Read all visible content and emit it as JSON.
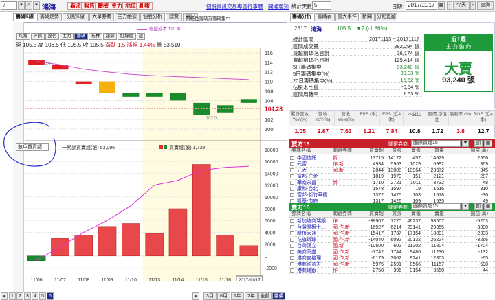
{
  "toolbar": {
    "code": "7",
    "stock_name": "鴻海",
    "buttons": [
      "看法",
      "報告",
      "體檢",
      "主力",
      "地位",
      "亂報"
    ],
    "links": [
      "個股資訊",
      "交易專區",
      "行事曆",
      "開通通知"
    ],
    "period_label": "統計天數:",
    "period_value": "5",
    "date_label": "日期:",
    "date_value": "2017/11/17",
    "today_btn": "今天",
    "query_btn": "查詢"
  },
  "left_tabs": [
    "籌碼K線",
    "籌碼走勢",
    "分點K線",
    "大單券商",
    "主力給據",
    "個股分析",
    "總覽",
    "筆記"
  ],
  "right_tabs": [
    "籌碼分析",
    "籌碼表",
    "重大事件",
    "新聞",
    "分點追蹤"
  ],
  "chart": {
    "note": "新紅色籌碼為籌碼集中",
    "avg_cost_label": "聯盟成本 110.40",
    "tools": [
      "均線",
      "外資",
      "投信",
      "主力",
      "籌碼",
      "布林",
      "趨勢",
      "紅綠燈"
    ],
    "active_tool": "籌碼",
    "tools_extra": "設",
    "ohlc_line": {
      "open": "開 105.5",
      "high": "高 106.5",
      "low": "低 105.5",
      "close": "收 105.5",
      "change": "漲跌 1.5",
      "pct": "漲幅 1.44%",
      "vol": "量 53,510"
    },
    "last_price": "104.28",
    "candle_hi_label": "114",
    "candle_lo_label": "102.5",
    "lower_selector": "散戶買賣超",
    "lower_legend_1": "一累計買賣超(張) 53,096",
    "lower_legend_2": "買賣超(張) 1,738",
    "dates": [
      "11/06",
      "11/07",
      "11/08",
      "11/09",
      "11/10",
      "11/13",
      "11/14",
      "11/15",
      "11/16",
      "2017/11/17"
    ],
    "year_label": "2017",
    "upper_ticks": [
      "116",
      "114",
      "112",
      "110",
      "108",
      "106",
      "104.28",
      "102",
      "100"
    ],
    "lower_ticks": [
      "18000",
      "16000",
      "14000",
      "12000",
      "10000",
      "8000",
      "6000",
      "4000",
      "2000",
      "0",
      "-2000"
    ],
    "pager": [
      "1",
      "2",
      "3",
      "4",
      "5",
      "6"
    ],
    "ranges": [
      "3月",
      "6月",
      "1年",
      "2年",
      "全部",
      "量價"
    ]
  },
  "chart_data": {
    "type": "bar",
    "categories": [
      "11/06",
      "11/07",
      "11/08",
      "11/09",
      "11/10",
      "11/13",
      "11/14",
      "11/15",
      "11/16",
      "11/17"
    ],
    "series": [
      {
        "name": "買賣超(張)",
        "values": [
          -800,
          3000,
          3500,
          5000,
          5500,
          3800,
          8000,
          15500,
          3500,
          1738
        ]
      },
      {
        "name": "累計買賣超(張)",
        "values": [
          -700,
          1500,
          4000,
          6000,
          8500,
          12000,
          12800,
          14500,
          15000,
          15200
        ]
      }
    ],
    "ylim": [
      -2000,
      18000
    ]
  },
  "summary": {
    "code": "2317",
    "name": "鴻海",
    "price": "105.5",
    "change": "▼2 (-1.86%)",
    "rows": [
      {
        "label": "統計區間",
        "value": "20171113 ~ 20171117",
        "cls": ""
      },
      {
        "label": "區間成交量",
        "value": "282,294 張",
        "cls": ""
      },
      {
        "label": "買超前15名合計",
        "value": "36,174 張",
        "cls": ""
      },
      {
        "label": "賣超前15名合計",
        "value": "-129,414 張",
        "cls": ""
      },
      {
        "label": "5日籌碼集中",
        "value": "-93,240 張",
        "cls": "grn"
      },
      {
        "label": "5日籌碼集中(%)",
        "value": "-33.03 %",
        "cls": "grn"
      },
      {
        "label": "20日籌碼集中(%)",
        "value": "-15.52 %",
        "cls": "grn"
      },
      {
        "label": "佔股本比重",
        "value": "-0.54 %",
        "cls": ""
      },
      {
        "label": "區間周轉率",
        "value": "1.63 %",
        "cls": ""
      }
    ],
    "signal_title": "近1週",
    "signal_sub": "主 力 動 向",
    "signal_main": "大賣",
    "signal_value": "93,240 張"
  },
  "fundamentals": {
    "headers": [
      "累計營收 YoY(%)",
      "營收 YoY(%)",
      "營收 MoM(%)",
      "EPS (季)",
      "EPS (近4季)",
      "本益比",
      "股價 淨值比",
      "殖利率 (%)",
      "ROE (近4季)"
    ],
    "values": [
      "1.05",
      "2.87",
      "7.63",
      "1.21",
      "7.84",
      "10.8",
      "1.72",
      "3.8",
      "12.7"
    ],
    "colors": [
      "red",
      "red",
      "red",
      "red",
      "red",
      "",
      "",
      "red",
      ""
    ]
  },
  "buyers": {
    "title": "買方15",
    "group_label": "關鍵券商:",
    "group_value": "國際買超15",
    "btn1": "▼",
    "btn2": "抓",
    "headers": [
      "券商名稱",
      "關鍵券商",
      "買賣超",
      "買張",
      "賣張",
      "買量",
      "損益(萬)"
    ],
    "rows": [
      [
        "中國信託",
        "新",
        "13715",
        "14172",
        "457",
        "14629",
        "2556"
      ],
      [
        "元富",
        "作,新",
        "4934",
        "5963",
        "1029",
        "6992",
        "369"
      ],
      [
        "元大",
        "國,新",
        "2044",
        "13008",
        "10964",
        "23972",
        "345"
      ],
      [
        "富邦-仁愛",
        "",
        "1819",
        "1970",
        "151",
        "2121",
        "287"
      ],
      [
        "華南永昌",
        "新",
        "1710",
        "2721",
        "1011",
        "3732",
        "48"
      ],
      [
        "康和-台北",
        "",
        "1578",
        "1597",
        "19",
        "1616",
        "310"
      ],
      [
        "富邦-新竹華德",
        "",
        "1372",
        "1475",
        "103",
        "1578",
        "-36"
      ],
      [
        "凱基-市府",
        "",
        "1317",
        "1426",
        "109",
        "1535",
        "49"
      ],
      [
        "新光",
        "出",
        "1314",
        "2465",
        "1151",
        "3616",
        "218"
      ]
    ]
  },
  "sellers": {
    "title": "賣方15",
    "group_label": "關鍵券商:",
    "group_value": "國際賣超15",
    "btn1": "▼",
    "btn2": "抓",
    "headers": [
      "券商名稱",
      "關鍵券商",
      "買賣超",
      "買張",
      "賣張",
      "賣量",
      "損益(萬)"
    ],
    "rows": [
      [
        "新加坡商瑞銀",
        "作",
        "-38967",
        "7270",
        "46237",
        "53507",
        "-5203"
      ],
      [
        "台灣摩根士...",
        "國,作,新",
        "-16927",
        "6214",
        "23141",
        "29355",
        "-3390"
      ],
      [
        "摩根大通",
        "國,作,新",
        "-15417",
        "1737",
        "17154",
        "18891",
        "-2333"
      ],
      [
        "花旗環球",
        "國,作,新",
        "-14040",
        "6092",
        "20132",
        "26224",
        "-3266"
      ],
      [
        "台灣匯立",
        "國,新",
        "-10600",
        "602",
        "11202",
        "11804",
        "-1704"
      ],
      [
        "美商高盛",
        "國,作,新",
        "-7742",
        "1744",
        "9486",
        "11230",
        "-132"
      ],
      [
        "港商麥格理",
        "國,作,新",
        "-6179",
        "3062",
        "9241",
        "12303",
        "-65"
      ],
      [
        "港商德意志",
        "國,作,新",
        "-5975",
        "2591",
        "8566",
        "11157",
        "-598"
      ],
      [
        "港商瑞銀",
        "作",
        "-2758",
        "396",
        "3154",
        "3550",
        "-44"
      ]
    ]
  }
}
